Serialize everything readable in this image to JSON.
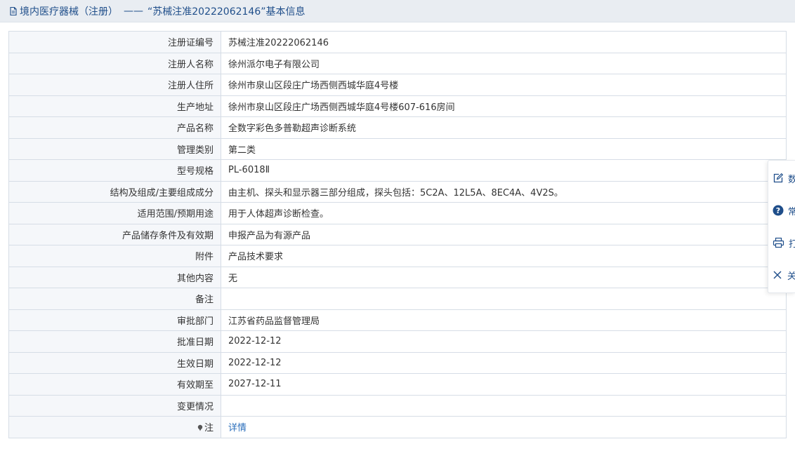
{
  "header": {
    "section": "境内医疗器械（注册）",
    "separator": "——",
    "title": "“苏械注准20222062146”基本信息"
  },
  "rows": [
    {
      "label": "注册证编号",
      "value": "苏械注准20222062146"
    },
    {
      "label": "注册人名称",
      "value": "徐州派尔电子有限公司"
    },
    {
      "label": "注册人住所",
      "value": "徐州市泉山区段庄广场西侧西城华庭4号楼"
    },
    {
      "label": "生产地址",
      "value": "徐州市泉山区段庄广场西侧西城华庭4号楼607-616房间"
    },
    {
      "label": "产品名称",
      "value": "全数字彩色多普勒超声诊断系统"
    },
    {
      "label": "管理类别",
      "value": "第二类"
    },
    {
      "label": "型号规格",
      "value": "PL-6018Ⅱ"
    },
    {
      "label": "结构及组成/主要组成成分",
      "value": "由主机、探头和显示器三部分组成，探头包括：5C2A、12L5A、8EC4A、4V2S。"
    },
    {
      "label": "适用范围/预期用途",
      "value": "用于人体超声诊断检查。"
    },
    {
      "label": "产品储存条件及有效期",
      "value": "申报产品为有源产品"
    },
    {
      "label": "附件",
      "value": "产品技术要求"
    },
    {
      "label": "其他内容",
      "value": "无"
    },
    {
      "label": "备注",
      "value": ""
    },
    {
      "label": "审批部门",
      "value": "江苏省药品监督管理局"
    },
    {
      "label": "批准日期",
      "value": "2022-12-12"
    },
    {
      "label": "生效日期",
      "value": "2022-12-12"
    },
    {
      "label": "有效期至",
      "value": "2027-12-11"
    },
    {
      "label": "变更情况",
      "value": ""
    }
  ],
  "note_row": {
    "label": "注",
    "link_text": "详情"
  },
  "float_bar": [
    {
      "icon": "edit-icon",
      "label": "数"
    },
    {
      "icon": "help-icon",
      "label": "常"
    },
    {
      "icon": "print-icon",
      "label": "打"
    },
    {
      "icon": "close-icon",
      "label": "关"
    }
  ],
  "colors": {
    "header_bg": "#e9edf2",
    "header_text": "#1f4e8a",
    "label_bg": "#f5f7fa",
    "border": "#d6dde6",
    "link": "#2a6ebb"
  }
}
